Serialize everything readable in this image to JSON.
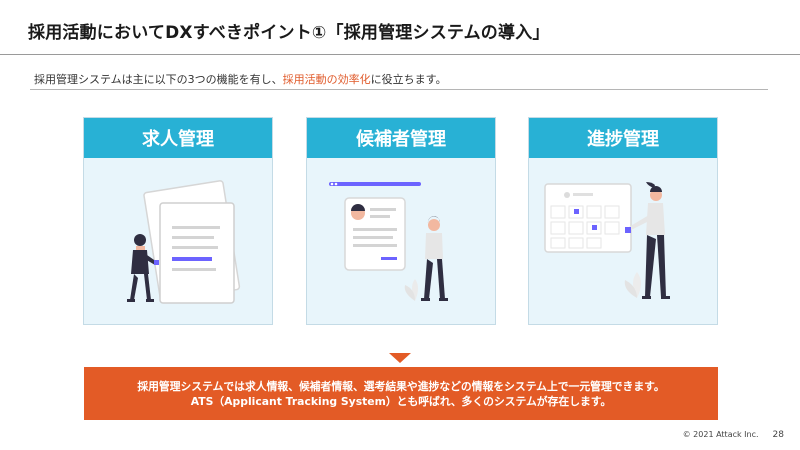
{
  "header": {
    "title": "採用活動においてDXすべきポイント①「採用管理システムの導入」"
  },
  "intro": {
    "text_before": "採用管理システムは主に以下の3つの機能を有し、",
    "text_highlight": "採用活動の効率化",
    "text_after": "に役立ちます。",
    "highlight_color": "#e05a2a"
  },
  "cards": [
    {
      "label": "求人管理"
    },
    {
      "label": "候補者管理"
    },
    {
      "label": "進捗管理"
    }
  ],
  "banner": {
    "line1": "採用管理システムでは求人情報、候補者情報、選考結果や進捗などの情報をシステム上で一元管理できます。",
    "line2": "ATS（Applicant Tracking System）とも呼ばれ、多くのシステムが存在します。"
  },
  "footer": {
    "copyright": "© 2021 Attack Inc.",
    "page_number": "28"
  },
  "colors": {
    "accent_blue": "#28b1d5",
    "accent_orange": "#e35b26",
    "card_bg": "#e8f5fb"
  }
}
